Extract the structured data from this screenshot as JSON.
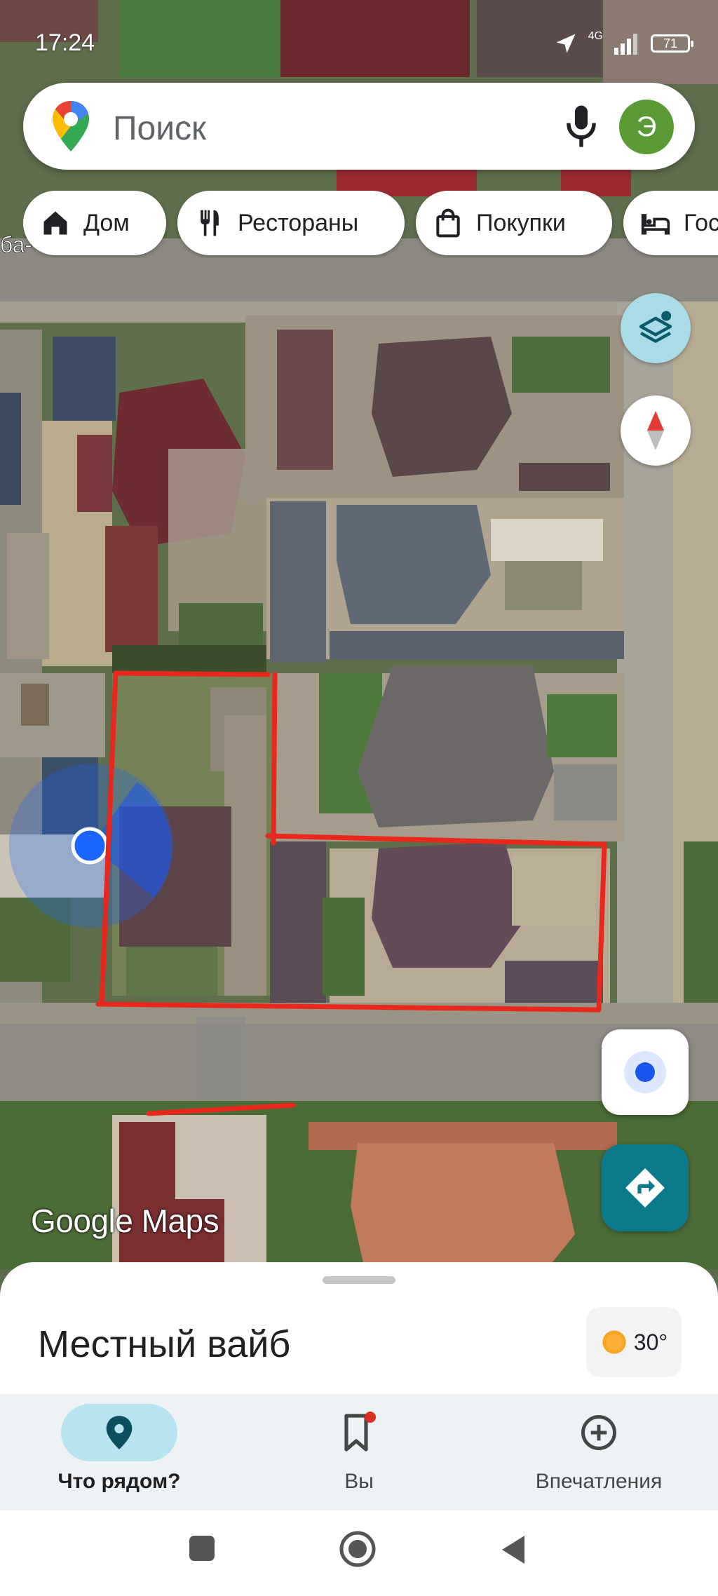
{
  "status_bar": {
    "time": "17:24",
    "network": "4G",
    "battery": "71"
  },
  "search": {
    "placeholder": "Поиск",
    "avatar_letter": "Э"
  },
  "chips": [
    {
      "label": "Дом",
      "icon": "home-icon"
    },
    {
      "label": "Рестораны",
      "icon": "restaurant-icon"
    },
    {
      "label": "Покупки",
      "icon": "shopping-bag-icon"
    },
    {
      "label": "Гос",
      "icon": "hotel-bed-icon"
    }
  ],
  "map": {
    "watermark": "Google Maps",
    "street_fragment": "ба-",
    "accent_colors": {
      "annotation_red": "#e8281c",
      "location_blue": "#1a66ff",
      "teal": "#0b7a8a"
    }
  },
  "sheet": {
    "title": "Местный вайб",
    "weather_temp": "30°",
    "weather_icon": "sun-icon"
  },
  "bottom_nav": [
    {
      "label": "Что рядом?",
      "icon": "location-pin-icon",
      "active": true
    },
    {
      "label": "Вы",
      "icon": "bookmark-icon",
      "active": false,
      "notification_dot": true
    },
    {
      "label": "Впечатления",
      "icon": "add-circle-icon",
      "active": false
    }
  ]
}
